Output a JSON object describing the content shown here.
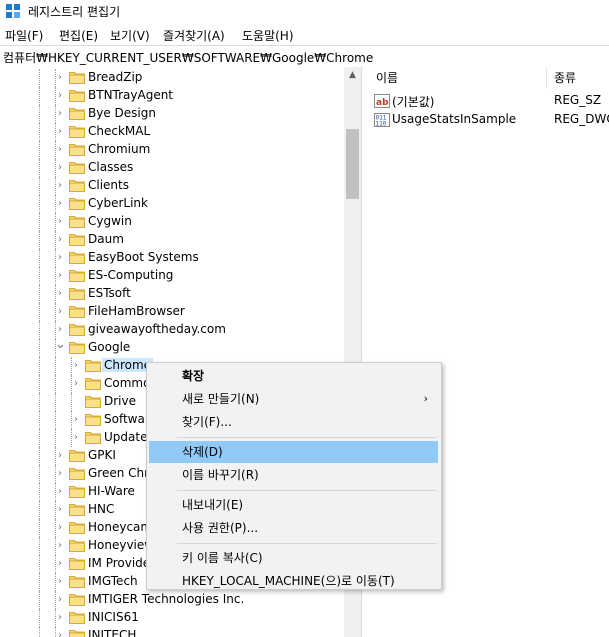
{
  "window": {
    "title": "레지스트리 편집기"
  },
  "menubar": {
    "items": [
      "파일(F)",
      "편집(E)",
      "보기(V)",
      "즐겨찾기(A)",
      "도움말(H)"
    ]
  },
  "address": {
    "path": "컴퓨터₩HKEY_CURRENT_USER₩SOFTWARE₩Google₩Chrome"
  },
  "tree": {
    "items": [
      {
        "label": "BreadZip",
        "expanded": false,
        "level": 1
      },
      {
        "label": "BTNTrayAgent",
        "expanded": false,
        "level": 1
      },
      {
        "label": "Bye Design",
        "expanded": false,
        "level": 1
      },
      {
        "label": "CheckMAL",
        "expanded": false,
        "level": 1
      },
      {
        "label": "Chromium",
        "expanded": false,
        "level": 1
      },
      {
        "label": "Classes",
        "expanded": false,
        "level": 1
      },
      {
        "label": "Clients",
        "expanded": false,
        "level": 1
      },
      {
        "label": "CyberLink",
        "expanded": false,
        "level": 1
      },
      {
        "label": "Cygwin",
        "expanded": false,
        "level": 1
      },
      {
        "label": "Daum",
        "expanded": false,
        "level": 1
      },
      {
        "label": "EasyBoot Systems",
        "expanded": false,
        "level": 1
      },
      {
        "label": "ES-Computing",
        "expanded": false,
        "level": 1
      },
      {
        "label": "ESTsoft",
        "expanded": false,
        "level": 1
      },
      {
        "label": "FileHamBrowser",
        "expanded": false,
        "level": 1
      },
      {
        "label": "giveawayoftheday.com",
        "expanded": false,
        "level": 1
      },
      {
        "label": "Google",
        "expanded": true,
        "level": 1
      },
      {
        "label": "Chrome",
        "expanded": false,
        "level": 2,
        "selected": true
      },
      {
        "label": "Common",
        "expanded": false,
        "level": 2
      },
      {
        "label": "Drive",
        "expanded": false,
        "level": 2,
        "leaf": true
      },
      {
        "label": "Software",
        "expanded": false,
        "level": 2
      },
      {
        "label": "Update",
        "expanded": false,
        "level": 2
      },
      {
        "label": "GPKI",
        "expanded": false,
        "level": 1
      },
      {
        "label": "Green Chrome",
        "expanded": false,
        "level": 1
      },
      {
        "label": "HI-Ware",
        "expanded": false,
        "level": 1
      },
      {
        "label": "HNC",
        "expanded": false,
        "level": 1
      },
      {
        "label": "Honeycam",
        "expanded": false,
        "level": 1
      },
      {
        "label": "Honeyview",
        "expanded": false,
        "level": 1
      },
      {
        "label": "IM Provider",
        "expanded": false,
        "level": 1
      },
      {
        "label": "IMGTech",
        "expanded": false,
        "level": 1
      },
      {
        "label": "IMTIGER Technologies Inc.",
        "expanded": false,
        "level": 1
      },
      {
        "label": "INICIS61",
        "expanded": false,
        "level": 1
      },
      {
        "label": "INITECH",
        "expanded": false,
        "level": 1
      }
    ]
  },
  "values": {
    "headers": [
      "이름",
      "종류"
    ],
    "rows": [
      {
        "name": "(기본값)",
        "type": "REG_SZ",
        "icon": "string-value-icon"
      },
      {
        "name": "UsageStatsInSample",
        "type": "REG_DWO",
        "icon": "binary-value-icon"
      }
    ]
  },
  "context_menu": {
    "items": [
      {
        "label": "확장",
        "bold": true
      },
      {
        "label": "새로 만들기(N)",
        "submenu": true
      },
      {
        "label": "찾기(F)..."
      },
      {
        "separator": true
      },
      {
        "label": "삭제(D)",
        "highlighted": true
      },
      {
        "label": "이름 바꾸기(R)"
      },
      {
        "separator": true
      },
      {
        "label": "내보내기(E)"
      },
      {
        "label": "사용 권한(P)..."
      },
      {
        "separator": true
      },
      {
        "label": "키 이름 복사(C)"
      },
      {
        "label": "HKEY_LOCAL_MACHINE(으)로 이동(T)"
      }
    ]
  },
  "colors": {
    "selection": "#cce8ff",
    "menu_highlight": "#91c9f7",
    "folder": "#f8d775"
  }
}
